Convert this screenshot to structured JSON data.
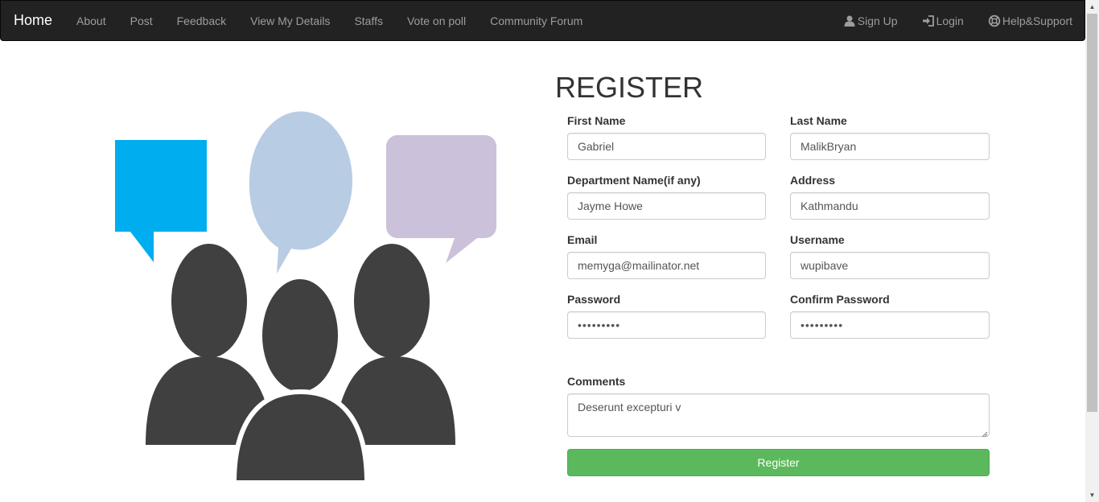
{
  "nav": {
    "brand": "Home",
    "links": [
      "About",
      "Post",
      "Feedback",
      "View My Details",
      "Staffs",
      "Vote on poll",
      "Community Forum"
    ],
    "right": [
      {
        "label": "Sign Up",
        "icon": "user-icon"
      },
      {
        "label": "Login",
        "icon": "login-icon"
      },
      {
        "label": "Help&Support",
        "icon": "lifebuoy-icon"
      }
    ]
  },
  "form": {
    "title": "REGISTER",
    "first_name": {
      "label": "First Name",
      "value": "Gabriel"
    },
    "last_name": {
      "label": "Last Name",
      "value": "MalikBryan"
    },
    "department": {
      "label": "Department Name(if any)",
      "value": "Jayme Howe"
    },
    "address": {
      "label": "Address",
      "value": "Kathmandu"
    },
    "email": {
      "label": "Email",
      "value": "memyga@mailinator.net"
    },
    "username": {
      "label": "Username",
      "value": "wupibave"
    },
    "password": {
      "label": "Password",
      "value": "•••••••••"
    },
    "confirm_password": {
      "label": "Confirm Password",
      "value": "•••••••••"
    },
    "comments": {
      "label": "Comments",
      "value": "Deserunt excepturi v"
    },
    "submit_label": "Register"
  },
  "colors": {
    "navbar_bg": "#222222",
    "nav_text": "#9d9d9d",
    "button_green": "#5cb85c",
    "bubble_blue": "#00adee",
    "bubble_lightblue": "#b8cce4",
    "bubble_lavender": "#ccc1da",
    "people_gray": "#404040"
  }
}
